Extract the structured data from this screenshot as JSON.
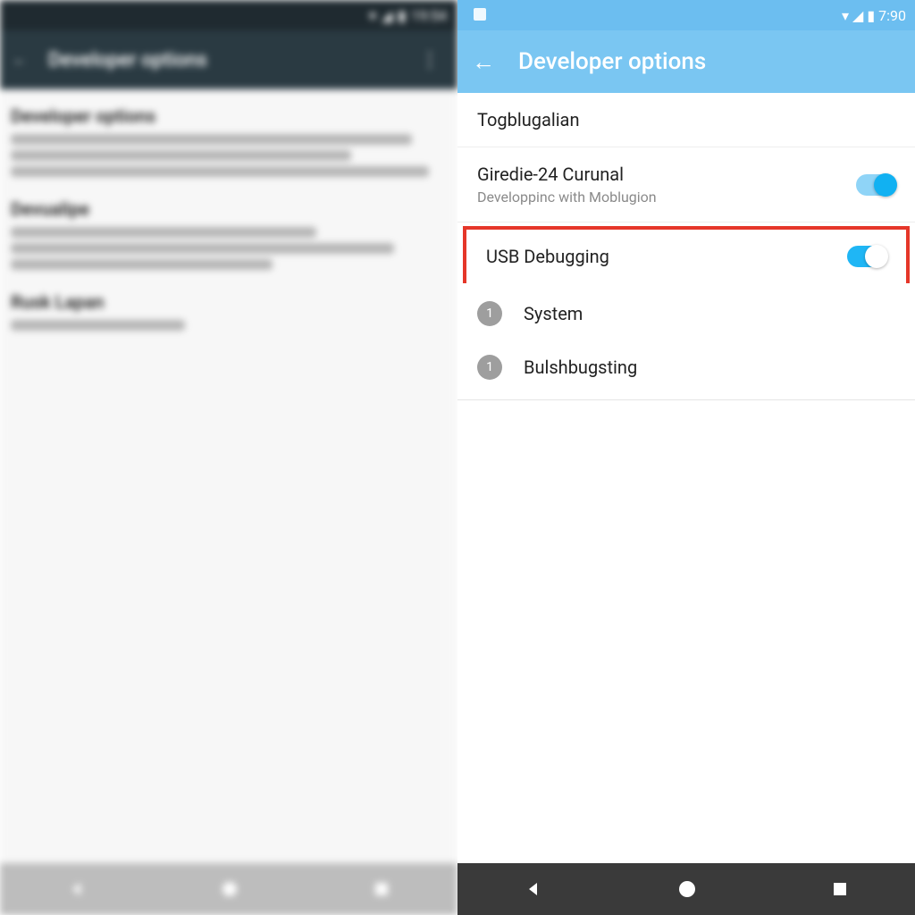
{
  "left": {
    "status": {
      "time": "19:54"
    },
    "appbar": {
      "title": "Developer options"
    },
    "sections": [
      {
        "title": "Developer options"
      },
      {
        "title": "Devualipe"
      },
      {
        "title": "Rusk Lapan"
      }
    ]
  },
  "right": {
    "status": {
      "time": "7:90"
    },
    "appbar": {
      "title": "Developer options"
    },
    "rows": {
      "togblugalian": {
        "label": "Togblugalian"
      },
      "giredie": {
        "label": "Giredie-24 Curunal",
        "sub": "Developpinc with Moblugion"
      },
      "usb": {
        "label": "USB Debugging"
      },
      "system": {
        "badge": "1",
        "label": "System"
      },
      "bulsh": {
        "badge": "1",
        "label": "Bulshbugsting"
      }
    }
  },
  "colors": {
    "accent": "#11b1f2",
    "appbar_light": "#7ac6f2",
    "highlight_border": "#e53629"
  }
}
